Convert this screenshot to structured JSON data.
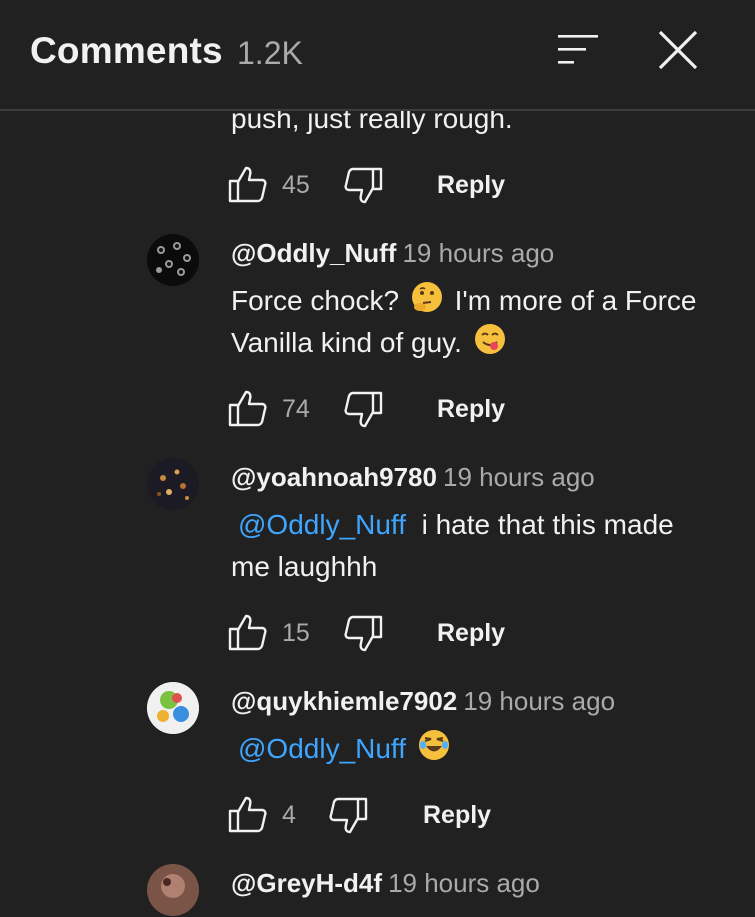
{
  "header": {
    "title": "Comments",
    "count": "1.2K"
  },
  "partial_comment": {
    "text_tail": "push, just really rough.",
    "likes": "45",
    "reply_label": "Reply"
  },
  "comments": [
    {
      "author": "@Oddly_Nuff",
      "time": "19 hours ago",
      "line1": "Force chock?",
      "line1b": "I'm more of a Force",
      "line2": "Vanilla kind of guy.",
      "likes": "74",
      "reply_label": "Reply"
    },
    {
      "author": "@yoahnoah9780",
      "time": "19 hours ago",
      "mention": "@Oddly_Nuff",
      "line1": "i hate that this made",
      "line2": "me laughhh",
      "likes": "15",
      "reply_label": "Reply"
    },
    {
      "author": "@quykhiemle7902",
      "time": "19 hours ago",
      "mention": "@Oddly_Nuff",
      "likes": "4",
      "reply_label": "Reply"
    },
    {
      "author": "@GreyH-d4f",
      "time": "19 hours ago"
    }
  ],
  "icons": [
    "sort-icon",
    "close-icon",
    "thumbs-up-icon",
    "thumbs-down-icon",
    "thinking-face-emoji",
    "yum-face-emoji",
    "laughing-face-emoji"
  ],
  "colors": {
    "background": "#212121",
    "text": "#f1f1f1",
    "secondary": "#aaaaaa",
    "mention": "#3ea6ff"
  }
}
